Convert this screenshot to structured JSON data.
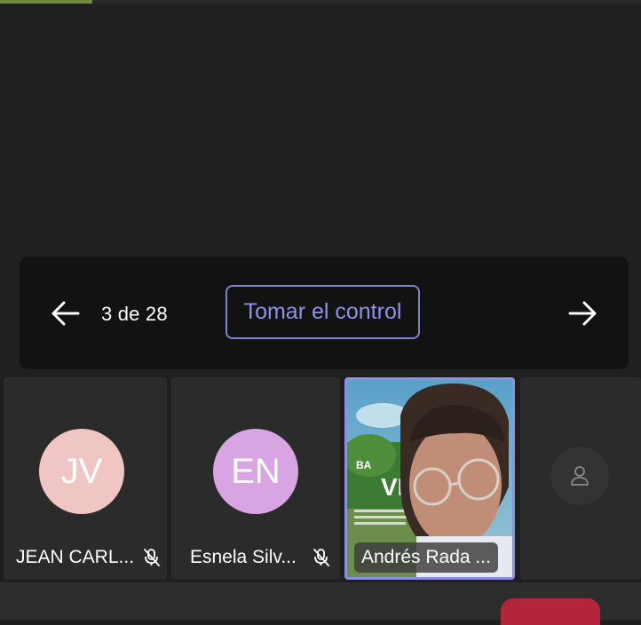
{
  "share_bar": {
    "page_indicator": "3 de 28",
    "take_control_label": "Tomar el control",
    "prev_icon": "arrow-left-icon",
    "next_icon": "arrow-right-icon"
  },
  "participants": [
    {
      "initials": "JV",
      "name": "JEAN CARL...",
      "muted": true,
      "avatar_color": "#f0c6c4"
    },
    {
      "initials": "EN",
      "name": "Esnela Silv...",
      "muted": true,
      "avatar_color": "#d8a4e2"
    },
    {
      "name": "Andrés Rada ...",
      "video": true,
      "active_speaker": true
    },
    {
      "placeholder_icon": "person-icon"
    }
  ],
  "colors": {
    "accent": "#8f93e8",
    "end_call": "#b3263a",
    "background": "#1f1f1f"
  }
}
